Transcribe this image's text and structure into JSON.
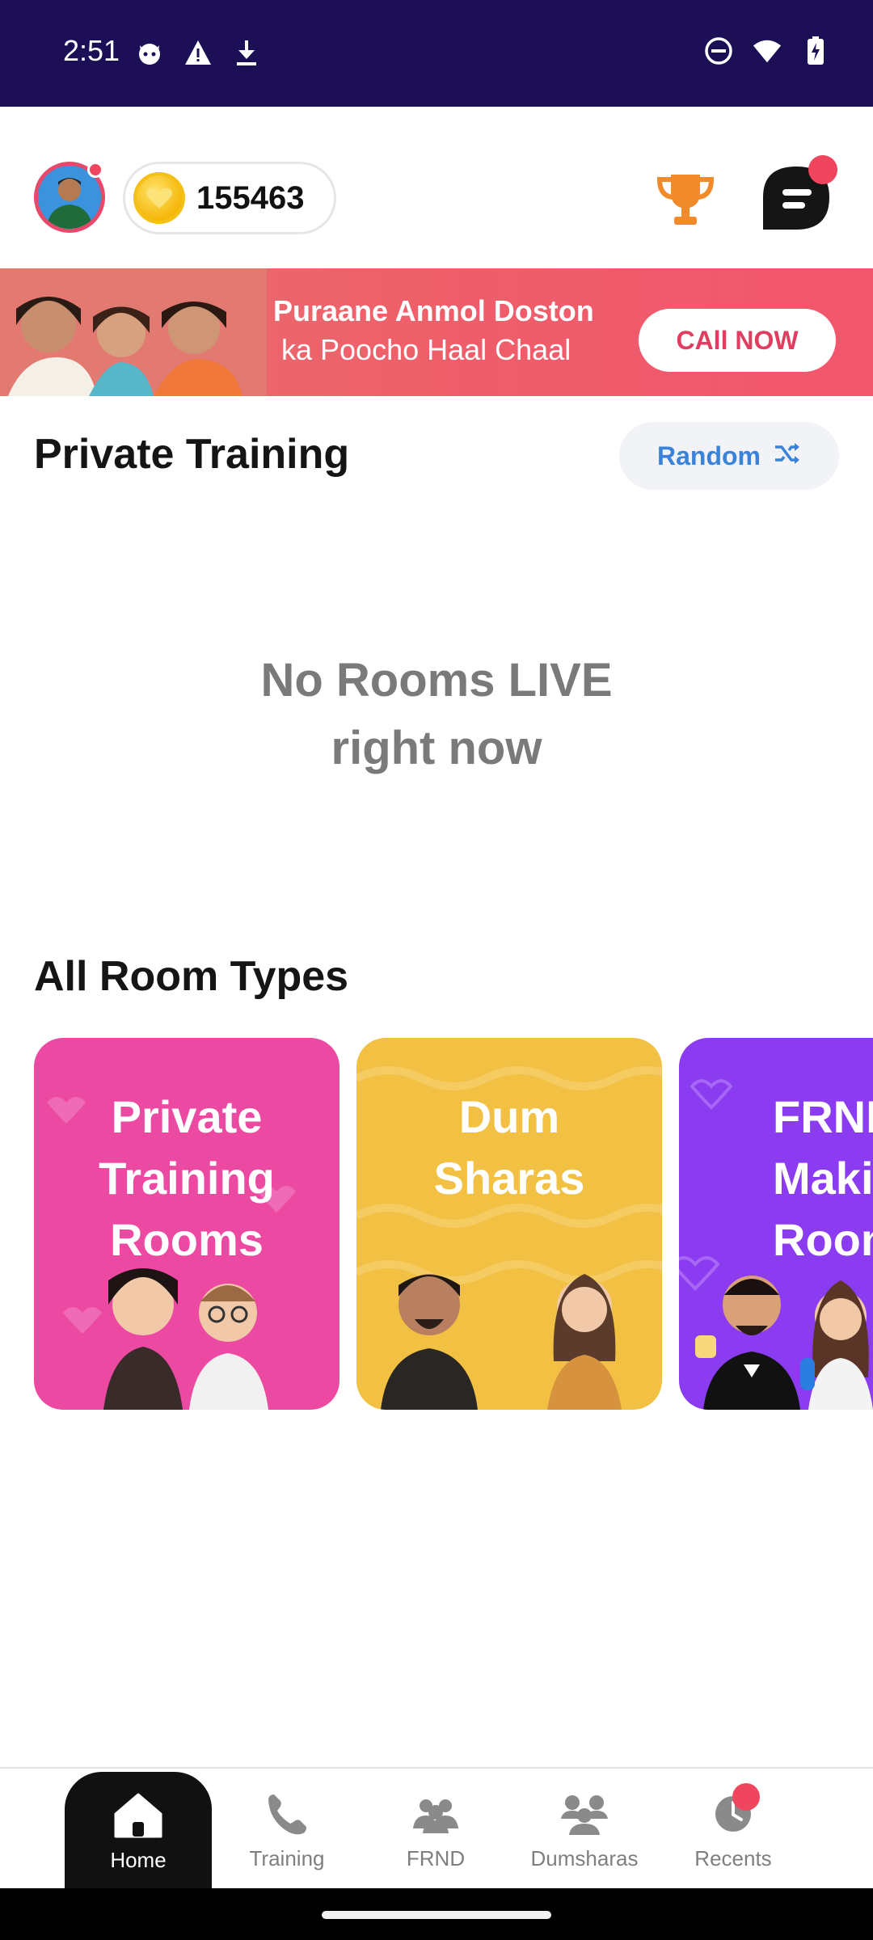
{
  "status_bar": {
    "time": "2:51",
    "left_icons": [
      "cat-face-icon",
      "alert-triangle-icon",
      "download-icon"
    ],
    "right_icons": [
      "do-not-disturb-icon",
      "wifi-icon",
      "battery-charging-icon"
    ]
  },
  "header": {
    "coins": "155463",
    "avatar_has_notification": true,
    "chat_has_notification": true
  },
  "banner": {
    "line1": "Puraane Anmol Doston",
    "line2": "ka Poocho Haal Chaal",
    "cta": "CAll NOW"
  },
  "private_training": {
    "title": "Private Training",
    "random_label": "Random",
    "empty_line1": "No Rooms LIVE",
    "empty_line2": "right now"
  },
  "room_types": {
    "title": "All Room Types",
    "cards": [
      {
        "line1": "Private",
        "line2": "Training",
        "line3": "Rooms",
        "color": "#ec4aa2"
      },
      {
        "line1": "Dum",
        "line2": "Sharas",
        "line3": "",
        "color": "#f2c043"
      },
      {
        "line1": "FRND",
        "line2": "Making",
        "line3": "Rooms",
        "color": "#8b3cf0"
      }
    ]
  },
  "bottom_nav": {
    "items": [
      {
        "label": "Home",
        "icon": "home-icon",
        "active": true
      },
      {
        "label": "Training",
        "icon": "phone-icon",
        "active": false
      },
      {
        "label": "FRND",
        "icon": "friends-icon",
        "active": false
      },
      {
        "label": "Dumsharas",
        "icon": "group-icon",
        "active": false
      },
      {
        "label": "Recents",
        "icon": "clock-icon",
        "active": false,
        "badge": true
      }
    ]
  },
  "colors": {
    "status_bar": "#1c0f55",
    "accent_red": "#f0455f",
    "random_blue": "#3b82d9",
    "trophy_orange": "#f08a2a"
  }
}
